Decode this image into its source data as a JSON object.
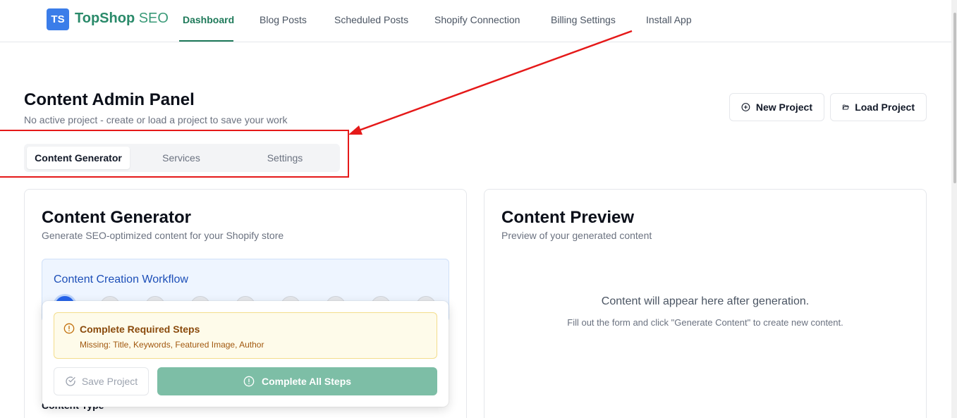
{
  "brand": {
    "badge": "TS",
    "name": "TopShop",
    "suffix": "SEO",
    "color": "#2a8a6a"
  },
  "nav": {
    "items": [
      {
        "label": "Dashboard",
        "active": true
      },
      {
        "label": "Blog Posts"
      },
      {
        "label": "Scheduled Posts"
      },
      {
        "label": "Shopify Connection"
      },
      {
        "label": "Billing Settings"
      },
      {
        "label": "Install App"
      }
    ]
  },
  "page": {
    "title": "Content Admin Panel",
    "subtitle": "No active project - create or load a project to save your work",
    "new_project": "New Project",
    "load_project": "Load Project"
  },
  "tabs": [
    {
      "label": "Content Generator",
      "active": true
    },
    {
      "label": "Services"
    },
    {
      "label": "Settings"
    }
  ],
  "generator": {
    "title": "Content Generator",
    "subtitle": "Generate SEO-optimized content for your Shopify store",
    "workflow_title": "Content Creation Workflow",
    "field_label": "Content Type"
  },
  "popup": {
    "alert_title": "Complete Required Steps",
    "alert_message": "Missing: Title, Keywords, Featured Image, Author",
    "save_label": "Save Project",
    "complete_label": "Complete All Steps"
  },
  "preview": {
    "title": "Content Preview",
    "subtitle": "Preview of your generated content",
    "empty_title": "Content will appear here after generation.",
    "empty_subtitle": "Fill out the form and click \"Generate Content\" to create new content."
  },
  "colors": {
    "accent": "#1f7a5a",
    "annotation": "#e51919",
    "primary": "#2563eb",
    "warning": "#8a4a0c"
  }
}
